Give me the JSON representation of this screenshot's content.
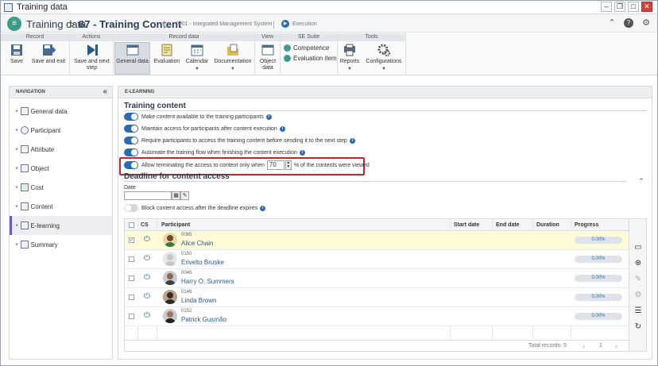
{
  "window": {
    "title": "Training data"
  },
  "header": {
    "module": "Training data",
    "separator": ">",
    "record": "67 - Training Content",
    "system": "0001 - Integrated Management System",
    "status": "Execution"
  },
  "ribbon": {
    "groups": {
      "record": "Record",
      "actions": "Actions",
      "record_data": "Record data",
      "view": "View",
      "se_suite": "SE Suite",
      "tools": "Tools"
    },
    "buttons": {
      "save": "Save",
      "save_exit": "Save and exit",
      "save_next": "Save and next step",
      "general_data": "General data",
      "evaluation": "Evaluation",
      "calendar": "Calendar",
      "documentation": "Documentation",
      "object_data": "Object data",
      "reports": "Reports",
      "configurations": "Configurations"
    },
    "suite": {
      "competence": "Competence",
      "evaluation_item": "Evaluation item"
    }
  },
  "navigation": {
    "title": "NAVIGATION",
    "collapse": "«",
    "items": [
      {
        "label": "General data",
        "icon": "form-icon"
      },
      {
        "label": "Participant",
        "icon": "users-icon"
      },
      {
        "label": "Attribute",
        "icon": "attribute-icon"
      },
      {
        "label": "Object",
        "icon": "object-icon"
      },
      {
        "label": "Cost",
        "icon": "cost-icon"
      },
      {
        "label": "Content",
        "icon": "content-icon"
      },
      {
        "label": "E-learning",
        "icon": "elearning-icon"
      },
      {
        "label": "Summary",
        "icon": "summary-icon"
      }
    ],
    "active_index": 6
  },
  "main": {
    "panel_title": "E-LEARNING",
    "training_content": {
      "title": "Training content",
      "options": [
        {
          "label": "Make content available to the training participants",
          "on": true
        },
        {
          "label": "Maintain access for participants after content execution",
          "on": true
        },
        {
          "label": "Require participants to access the training content before sending it to the next step",
          "on": true
        },
        {
          "label": "Automate the training flow when finishing the content execution",
          "on": true
        }
      ],
      "terminate": {
        "label_before": "Allow terminating the access to content only when",
        "value": "70",
        "label_after": "% of the contents were viewed",
        "on": true
      }
    },
    "deadline": {
      "title": "Deadline for content access",
      "date_label": "Date",
      "date_value": "",
      "block_label": "Block content access after the deadline expires",
      "block_on": false
    },
    "grid": {
      "columns": {
        "cs": "CS",
        "participant": "Participant",
        "start": "Start date",
        "end": "End date",
        "duration": "Duration",
        "progress": "Progress"
      },
      "rows": [
        {
          "code": "0085",
          "name": "Alice Chain",
          "start": "",
          "end": "",
          "duration": "",
          "progress": "0.00%",
          "checked": true,
          "avatar": "female"
        },
        {
          "code": "0150",
          "name": "Erivelto Bruske",
          "start": "",
          "end": "",
          "duration": "",
          "progress": "0.00%",
          "checked": false,
          "avatar": "default"
        },
        {
          "code": "0046",
          "name": "Harry O. Summers",
          "start": "",
          "end": "",
          "duration": "",
          "progress": "0.00%",
          "checked": false,
          "avatar": "male"
        },
        {
          "code": "0146",
          "name": "Linda Brown",
          "start": "",
          "end": "",
          "duration": "",
          "progress": "0.00%",
          "checked": false,
          "avatar": "female"
        },
        {
          "code": "0152",
          "name": "Patrick Gusmão",
          "start": "",
          "end": "",
          "duration": "",
          "progress": "0.00%",
          "checked": false,
          "avatar": "male"
        }
      ],
      "footer": {
        "total": "Total records: 5",
        "page": "1",
        "prev": "‹",
        "next": "›"
      }
    }
  },
  "colors": {
    "accent": "#2b6cb0",
    "highlight": "#c0272d",
    "selected_row": "#fffbd6",
    "nav_active": "#6a5acd"
  }
}
